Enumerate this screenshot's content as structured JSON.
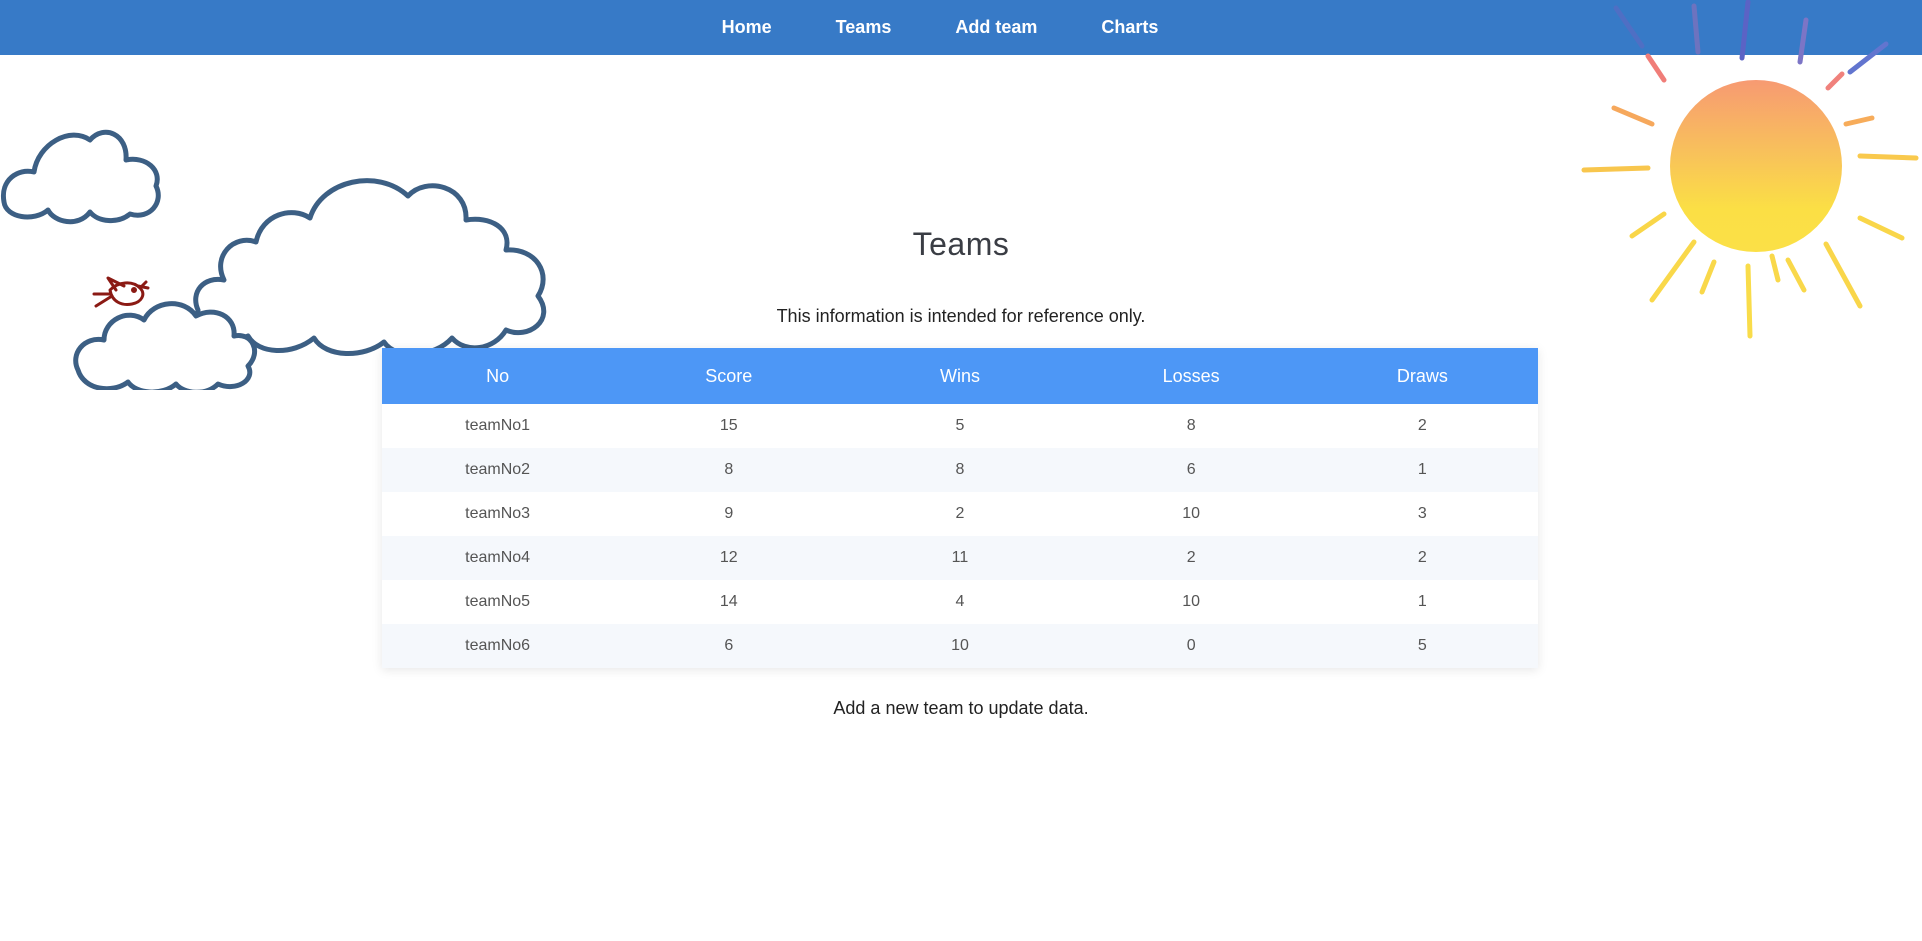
{
  "nav": {
    "items": [
      {
        "label": "Home"
      },
      {
        "label": "Teams"
      },
      {
        "label": "Add team"
      },
      {
        "label": "Charts"
      }
    ]
  },
  "main": {
    "title": "Teams",
    "subtitle": "This information is intended for reference only.",
    "table": {
      "headers": [
        "No",
        "Score",
        "Wins",
        "Losses",
        "Draws"
      ],
      "rows": [
        [
          "teamNo1",
          "15",
          "5",
          "8",
          "2"
        ],
        [
          "teamNo2",
          "8",
          "8",
          "6",
          "1"
        ],
        [
          "teamNo3",
          "9",
          "2",
          "10",
          "3"
        ],
        [
          "teamNo4",
          "12",
          "11",
          "2",
          "2"
        ],
        [
          "teamNo5",
          "14",
          "4",
          "10",
          "1"
        ],
        [
          "teamNo6",
          "6",
          "10",
          "0",
          "5"
        ]
      ]
    },
    "footer_note": "Add a new team to update data."
  },
  "decorations": {
    "sun": "sun-illustration",
    "clouds": "clouds-illustration",
    "bird": "bird-illustration"
  },
  "colors": {
    "navbar": "#377ac7",
    "table_header": "#4d97f6",
    "row_alt": "#f5f8fc",
    "sun_top": "#f79a72",
    "sun_bottom": "#fbdf45",
    "cloud_outline": "#3c5f84",
    "bird": "#8b1a14"
  }
}
